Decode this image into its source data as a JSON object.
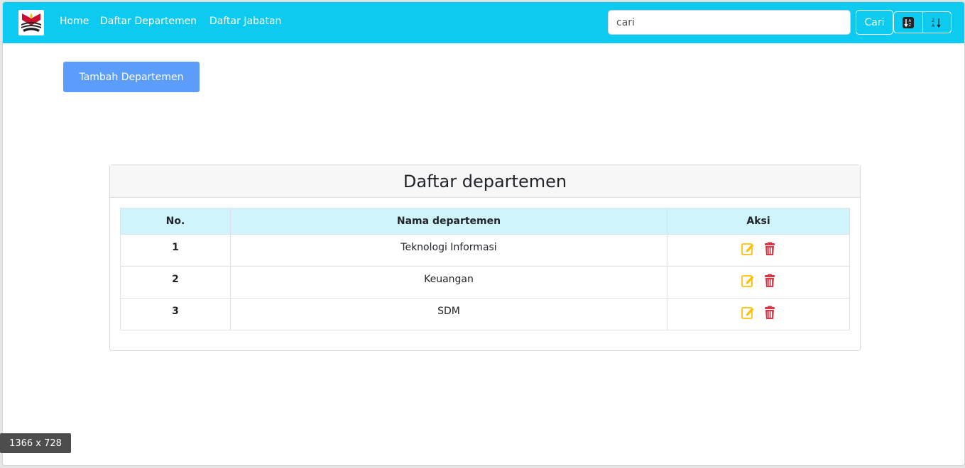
{
  "nav": {
    "links": [
      "Home",
      "Daftar Departemen",
      "Daftar Jabatan"
    ],
    "search_placeholder": "cari",
    "search_button": "Cari",
    "sort_icons": [
      "sort-alpha-down-icon",
      "sort-alpha-up-icon"
    ],
    "brand_color": "#0dcaf0"
  },
  "actions": {
    "add_button": "Tambah Departemen"
  },
  "card": {
    "title": "Daftar departemen",
    "table": {
      "headers": [
        "No.",
        "Nama departemen",
        "Aksi"
      ],
      "rows": [
        {
          "no": "1",
          "name": "Teknologi Informasi"
        },
        {
          "no": "2",
          "name": "Keuangan"
        },
        {
          "no": "3",
          "name": "SDM"
        }
      ],
      "row_icons": [
        "edit-icon",
        "trash-icon"
      ]
    }
  },
  "viewport_badge": "1366 x 728"
}
